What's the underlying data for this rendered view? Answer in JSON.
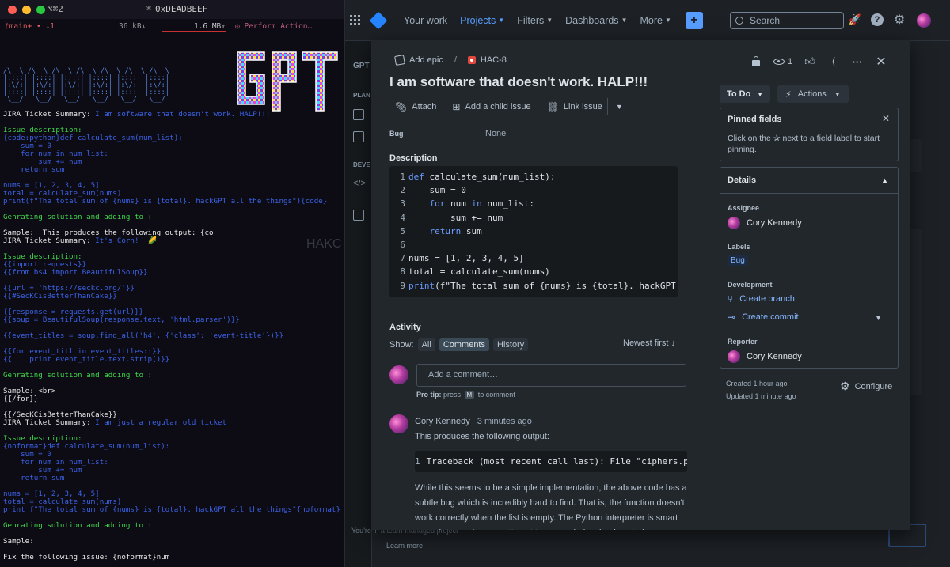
{
  "terminal": {
    "tab_label": "⌥⌘2",
    "host": "0xDEADBEEF",
    "branch": "ᚠmain+ • ↓1",
    "net": "36 kB↓",
    "mem": "1.6 MB↑",
    "action": "◎ Perform Action…",
    "lines": [
      {
        "t": "JIRA Ticket Summary: ",
        "c": "c-white",
        "t2": "I am software that doesn't work. HALP!!!",
        "c2": "c-blue"
      },
      {
        "t": "",
        "c": "c-white"
      },
      {
        "t": "Issue description:",
        "c": "c-green"
      },
      {
        "t": "{code:python}def calculate_sum(num_list):",
        "c": "c-blue"
      },
      {
        "t": "    sum = 0",
        "c": "c-blue"
      },
      {
        "t": "    for num in num_list:",
        "c": "c-blue"
      },
      {
        "t": "        sum += num",
        "c": "c-blue"
      },
      {
        "t": "    return sum",
        "c": "c-blue"
      },
      {
        "t": "",
        "c": "c-white"
      },
      {
        "t": "nums = [1, 2, 3, 4, 5]",
        "c": "c-blue"
      },
      {
        "t": "total = calculate_sum(nums)",
        "c": "c-blue"
      },
      {
        "t": "print(f\"The total sum of {nums} is {total}. hackGPT all the things\"){code}",
        "c": "c-blue"
      },
      {
        "t": "",
        "c": "c-white"
      },
      {
        "t": "Genrating solution and adding to :",
        "c": "c-green"
      },
      {
        "t": "",
        "c": "c-white"
      },
      {
        "t": "Sample:  This produces the following output: {co",
        "c": "c-white"
      },
      {
        "t": "JIRA Ticket Summary: ",
        "c": "c-white",
        "t2": "It's Corn!  🌽",
        "c2": "c-blue"
      },
      {
        "t": "",
        "c": "c-white"
      },
      {
        "t": "Issue description:",
        "c": "c-green"
      },
      {
        "t": "{{import requests}}",
        "c": "c-blue"
      },
      {
        "t": "{{from bs4 import BeautifulSoup}}",
        "c": "c-blue"
      },
      {
        "t": "",
        "c": "c-white"
      },
      {
        "t": "{{url = 'https://seckc.org/'}}",
        "c": "c-blue"
      },
      {
        "t": "{{#SecKCisBetterThanCake}}",
        "c": "c-blue"
      },
      {
        "t": "",
        "c": "c-white"
      },
      {
        "t": "{{response = requests.get(url)}}",
        "c": "c-blue"
      },
      {
        "t": "{{soup = BeautifulSoup(response.text, 'html.parser')}}",
        "c": "c-blue"
      },
      {
        "t": "",
        "c": "c-white"
      },
      {
        "t": "{{event_titles = soup.find_all('h4', {'class': 'event-title'})}}",
        "c": "c-blue"
      },
      {
        "t": "",
        "c": "c-white"
      },
      {
        "t": "{{for event_titl in event_titles::}}",
        "c": "c-blue"
      },
      {
        "t": "{{    print event_title.text.strip()}}",
        "c": "c-blue"
      },
      {
        "t": "",
        "c": "c-white"
      },
      {
        "t": "Genrating solution and adding to :",
        "c": "c-green"
      },
      {
        "t": "",
        "c": "c-white"
      },
      {
        "t": "Sample: <br>",
        "c": "c-white"
      },
      {
        "t": "{{/for}}",
        "c": "c-white"
      },
      {
        "t": "",
        "c": "c-white"
      },
      {
        "t": "{{/SecKCisBetterThanCake}}",
        "c": "c-white"
      },
      {
        "t": "JIRA Ticket Summary: ",
        "c": "c-white",
        "t2": "I am just a regular old ticket",
        "c2": "c-blue"
      },
      {
        "t": "",
        "c": "c-white"
      },
      {
        "t": "Issue description:",
        "c": "c-green"
      },
      {
        "t": "{noformat}def calculate_sum(num_list):",
        "c": "c-blue"
      },
      {
        "t": "    sum = 0",
        "c": "c-blue"
      },
      {
        "t": "    for num in num_list:",
        "c": "c-blue"
      },
      {
        "t": "        sum += num",
        "c": "c-blue"
      },
      {
        "t": "    return sum",
        "c": "c-blue"
      },
      {
        "t": "",
        "c": "c-white"
      },
      {
        "t": "nums = [1, 2, 3, 4, 5]",
        "c": "c-blue"
      },
      {
        "t": "total = calculate_sum(nums)",
        "c": "c-blue"
      },
      {
        "t": "print f\"The total sum of {nums} is {total}. hackGPT all the things\"{noformat}",
        "c": "c-blue"
      },
      {
        "t": "",
        "c": "c-white"
      },
      {
        "t": "Genrating solution and adding to :",
        "c": "c-green"
      },
      {
        "t": "",
        "c": "c-white"
      },
      {
        "t": "Sample:",
        "c": "c-white"
      },
      {
        "t": "",
        "c": "c-white"
      },
      {
        "t": "Fix the following issue: {noformat}num",
        "c": "c-white"
      }
    ]
  },
  "nav": {
    "items": [
      "Your work",
      "Projects",
      "Filters",
      "Dashboards",
      "More"
    ],
    "active_index": 1,
    "search_placeholder": "Search"
  },
  "board": {
    "sidebar_labels": [
      "GPT",
      "PLAN",
      "DEVE"
    ],
    "ghost_text": "HAKC",
    "footer_team": "You're in a team-managed project",
    "footer_learn": "Learn more"
  },
  "issue": {
    "add_epic": "Add epic",
    "key": "HAC-8",
    "watchers": "1",
    "title": "I am software that doesn't work. HALP!!!",
    "toolbar": {
      "attach": "Attach",
      "child": "Add a child issue",
      "link": "Link issue"
    },
    "field_label": "Bug",
    "field_value": "None",
    "description_label": "Description",
    "code_lines": [
      {
        "n": "1",
        "parts": [
          {
            "k": "kw",
            "t": "def"
          },
          {
            "k": "",
            "t": " calculate_sum(num_list):"
          }
        ]
      },
      {
        "n": "2",
        "parts": [
          {
            "k": "",
            "t": "    sum = 0"
          }
        ]
      },
      {
        "n": "3",
        "parts": [
          {
            "k": "",
            "t": "    "
          },
          {
            "k": "kw",
            "t": "for"
          },
          {
            "k": "",
            "t": " num "
          },
          {
            "k": "kw",
            "t": "in"
          },
          {
            "k": "",
            "t": " num_list:"
          }
        ]
      },
      {
        "n": "4",
        "parts": [
          {
            "k": "",
            "t": "        sum += num"
          }
        ]
      },
      {
        "n": "5",
        "parts": [
          {
            "k": "",
            "t": "    "
          },
          {
            "k": "kw",
            "t": "return"
          },
          {
            "k": "",
            "t": " sum"
          }
        ]
      },
      {
        "n": "6",
        "parts": [
          {
            "k": "",
            "t": ""
          }
        ]
      },
      {
        "n": "7",
        "parts": [
          {
            "k": "",
            "t": "nums = [1, 2, 3, 4, 5]"
          }
        ]
      },
      {
        "n": "8",
        "parts": [
          {
            "k": "",
            "t": "total = calculate_sum(nums)"
          }
        ]
      },
      {
        "n": "9",
        "parts": [
          {
            "k": "kw",
            "t": "print"
          },
          {
            "k": "",
            "t": "(f\"The total sum of {nums} is {total}. hackGPT all t"
          }
        ]
      }
    ],
    "activity": {
      "label": "Activity",
      "show_label": "Show:",
      "filters": [
        "All",
        "Comments",
        "History"
      ],
      "selected_filter": "Comments",
      "sort": "Newest first ↓",
      "comment_placeholder": "Add a comment…",
      "pro_tip_bold": "Pro tip:",
      "pro_tip_text1": "press",
      "pro_tip_key": "M",
      "pro_tip_text2": "to comment"
    },
    "comment": {
      "author": "Cory Kennedy",
      "time": "3 minutes ago",
      "intro": "This produces the following output:",
      "code_ln": "1",
      "code": "Traceback (most recent call last): File \"ciphers.py\",",
      "body": "While this seems to be a simple implementation, the above code has a subtle bug which is incredibly hard to find. That is, the function doesn't work correctly when the list is empty. The Python interpreter is smart enough to crash on an attempt to use an index that is out of range. This is"
    }
  },
  "panel": {
    "status": "To Do",
    "actions": "Actions",
    "pinned_title": "Pinned fields",
    "pinned_text": "Click on the ✰ next to a field label to start pinning.",
    "details_title": "Details",
    "assignee_label": "Assignee",
    "assignee": "Cory Kennedy",
    "labels_label": "Labels",
    "labels_value": "Bug",
    "development_label": "Development",
    "create_branch": "Create branch",
    "create_commit": "Create commit",
    "reporter_label": "Reporter",
    "reporter": "Cory Kennedy",
    "created": "Created 1 hour ago",
    "updated": "Updated 1 minute ago",
    "configure": "Configure"
  }
}
